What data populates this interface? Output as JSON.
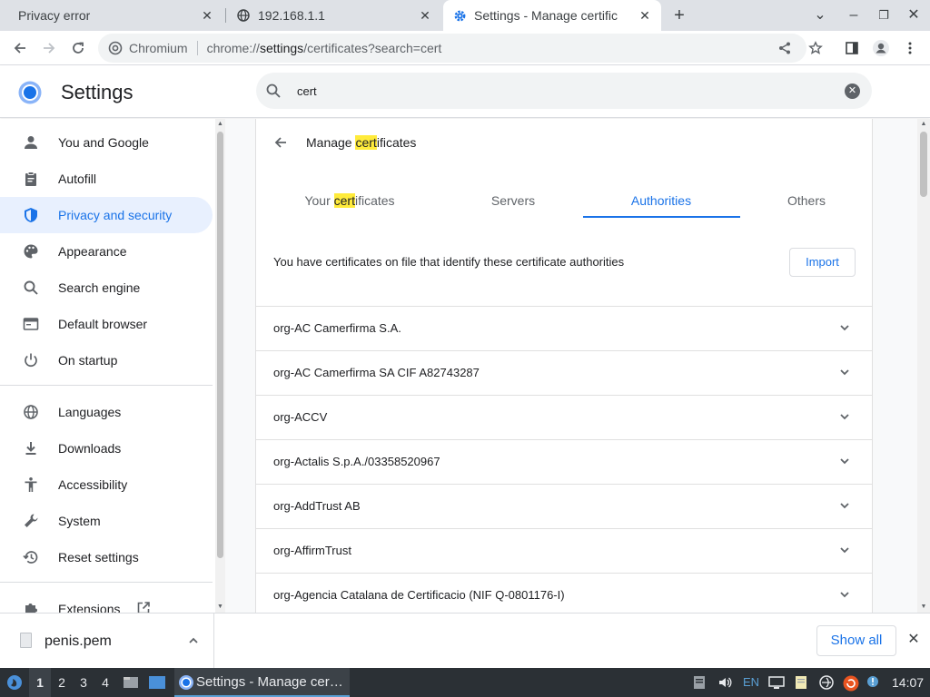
{
  "tabs": [
    {
      "title": "Privacy error",
      "close": "✕"
    },
    {
      "title": "192.168.1.1",
      "close": "✕"
    },
    {
      "title": "Settings - Manage certific",
      "close": "✕"
    }
  ],
  "tabstrip": {
    "new_tab": "+",
    "tab_search": "⌄",
    "minimize": "–",
    "restore": "❐",
    "close": "✕"
  },
  "omnibox": {
    "site_label": "Chromium",
    "url_prefix": "chrome://",
    "url_host": "settings",
    "url_path": "/certificates?search=cert"
  },
  "header": {
    "title": "Settings",
    "search_value": "cert"
  },
  "sidebar": {
    "items": [
      {
        "label": "You and Google",
        "icon": "person-icon"
      },
      {
        "label": "Autofill",
        "icon": "clipboard-icon"
      },
      {
        "label": "Privacy and security",
        "icon": "shield-icon"
      },
      {
        "label": "Appearance",
        "icon": "palette-icon"
      },
      {
        "label": "Search engine",
        "icon": "search-icon"
      },
      {
        "label": "Default browser",
        "icon": "browser-icon"
      },
      {
        "label": "On startup",
        "icon": "power-icon"
      },
      {
        "label": "Languages",
        "icon": "globe-icon"
      },
      {
        "label": "Downloads",
        "icon": "download-icon"
      },
      {
        "label": "Accessibility",
        "icon": "accessibility-icon"
      },
      {
        "label": "System",
        "icon": "wrench-icon"
      },
      {
        "label": "Reset settings",
        "icon": "history-icon"
      },
      {
        "label": "Extensions",
        "icon": "puzzle-icon"
      }
    ]
  },
  "card": {
    "title_pre": "Manage ",
    "title_hl": "cert",
    "title_post": "ificates",
    "tabs": [
      {
        "pre": "Your ",
        "hl": "cert",
        "post": "ificates"
      },
      {
        "label": "Servers"
      },
      {
        "label": "Authorities"
      },
      {
        "label": "Others"
      }
    ],
    "info": "You have certificates on file that identify these certificate authorities",
    "import_label": "Import",
    "authorities": [
      "org-AC Camerfirma S.A.",
      "org-AC Camerfirma SA CIF A82743287",
      "org-ACCV",
      "org-Actalis S.p.A./03358520967",
      "org-AddTrust AB",
      "org-AffirmTrust",
      "org-Agencia Catalana de Certificacio (NIF Q-0801176-I)"
    ]
  },
  "download_shelf": {
    "file_name": "penis.pem",
    "show_all": "Show all"
  },
  "taskbar": {
    "workspaces": [
      "1",
      "2",
      "3",
      "4"
    ],
    "window_title": "Settings - Manage cer…",
    "language": "EN",
    "clock": "14:07"
  },
  "colors": {
    "accent": "#1a73e8",
    "highlight": "#ffeb3b",
    "active_nav_bg": "#e8f0fe",
    "taskbar": "#2b3035"
  }
}
